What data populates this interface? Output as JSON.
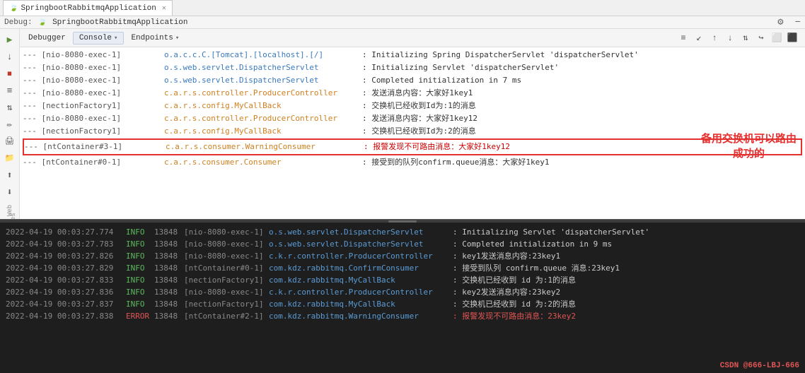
{
  "tabs": [
    {
      "label": "SpringbootRabbitmqApplication",
      "icon": "spring-icon"
    }
  ],
  "debugHeader": {
    "debug_label": "Debug:",
    "title": "SpringbootRabbitmqApplication"
  },
  "consoleTabs": [
    {
      "label": "Debugger",
      "active": false
    },
    {
      "label": "Console",
      "active": true,
      "arrow": "▾"
    },
    {
      "label": "Endpoints",
      "active": false,
      "arrow": "▾"
    }
  ],
  "subToolbarButtons": [
    "≡",
    "↙",
    "↑",
    "↓",
    "⇅",
    "↪",
    "⬜",
    "⬛"
  ],
  "leftToolbar": [
    "▶",
    "⏸",
    "⏹",
    "≡",
    "⇅",
    "✏",
    "🖨",
    "📁",
    "⬆",
    "⬇",
    "*"
  ],
  "logLines": [
    {
      "prefix": "--- [nio-8080-exec-1]",
      "class": "o.a.c.c.C.[Tomcat].[localhost].[/]",
      "msg": ": Initializing Spring DispatcherServlet 'dispatcherServlet'",
      "highlighted": false
    },
    {
      "prefix": "--- [nio-8080-exec-1]",
      "class": "o.s.web.servlet.DispatcherServlet",
      "msg": ": Initializing Servlet 'dispatcherServlet'",
      "highlighted": false
    },
    {
      "prefix": "--- [nio-8080-exec-1]",
      "class": "o.s.web.servlet.DispatcherServlet",
      "msg": ": Completed initialization in 7 ms",
      "highlighted": false
    },
    {
      "prefix": "--- [nio-8080-exec-1]",
      "class": "c.a.r.s.controller.ProducerController",
      "msg": ": 发送消息内容：大家好1key1",
      "highlighted": false,
      "classColor": "orange"
    },
    {
      "prefix": "--- [nectionFactory1]",
      "class": "c.a.r.s.config.MyCallBack",
      "msg": ": 交换机已经收到Id为:1的消息",
      "highlighted": false,
      "classColor": "orange"
    },
    {
      "prefix": "--- [nio-8080-exec-1]",
      "class": "c.a.r.s.controller.ProducerController",
      "msg": ": 发送消息内容：大家好1key12",
      "highlighted": false,
      "classColor": "orange"
    },
    {
      "prefix": "--- [nectionFactory1]",
      "class": "c.a.r.s.config.MyCallBack",
      "msg": ": 交换机已经收到Id为:2的消息",
      "highlighted": false,
      "classColor": "orange"
    },
    {
      "prefix": "--- [ntContainer#3-1]",
      "class": "c.a.r.s.consumer.WarningConsumer",
      "msg": ": 报警发现不可路由消息：大家好1key12",
      "highlighted": true,
      "classColor": "orange",
      "msgColor": "red"
    },
    {
      "prefix": "--- [ntContainer#0-1]",
      "class": "c.a.r.s.consumer.Consumer",
      "msg": ": 接受到的队列confirm.queue消息：大家好1key1",
      "highlighted": false,
      "classColor": "orange"
    }
  ],
  "annotation": {
    "line1": "备用交换机可以路由",
    "line2": "成功的"
  },
  "bottomLogs": [
    {
      "time": "2022-04-19 00:03:27.774",
      "level": "INFO",
      "pid": "13848",
      "thread": "[nio-8080-exec-1]",
      "class": "o.s.web.servlet.DispatcherServlet",
      "msg": ": Initializing Servlet 'dispatcherServlet'"
    },
    {
      "time": "2022-04-19 00:03:27.783",
      "level": "INFO",
      "pid": "13848",
      "thread": "[nio-8080-exec-1]",
      "class": "o.s.web.servlet.DispatcherServlet",
      "msg": ": Completed initialization in 9 ms"
    },
    {
      "time": "2022-04-19 00:03:27.826",
      "level": "INFO",
      "pid": "13848",
      "thread": "[nio-8080-exec-1]",
      "class": "c.k.r.controller.ProducerController",
      "msg": ": key1发送消息内容:23key1"
    },
    {
      "time": "2022-04-19 00:03:27.829",
      "level": "INFO",
      "pid": "13848",
      "thread": "[ntContainer#0-1]",
      "class": "com.kdz.rabbitmq.ConfirmConsumer",
      "msg": ": 接受到队列 confirm.queue 消息:23key1"
    },
    {
      "time": "2022-04-19 00:03:27.833",
      "level": "INFO",
      "pid": "13848",
      "thread": "[nectionFactory1]",
      "class": "com.kdz.rabbitmq.MyCallBack",
      "msg": ": 交换机已经收到 id 为:1的消息"
    },
    {
      "time": "2022-04-19 00:03:27.836",
      "level": "INFO",
      "pid": "13848",
      "thread": "[nio-8080-exec-1]",
      "class": "c.k.r.controller.ProducerController",
      "msg": ": key2发送消息内容:23key2"
    },
    {
      "time": "2022-04-19 00:03:27.837",
      "level": "INFO",
      "pid": "13848",
      "thread": "[nectionFactory1]",
      "class": "com.kdz.rabbitmq.MyCallBack",
      "msg": ": 交换机已经收到 id 为:2的消息"
    },
    {
      "time": "2022-04-19 00:03:27.838",
      "level": "ERROR",
      "pid": "13848",
      "thread": "[ntContainer#2-1]",
      "class": "com.kdz.rabbitmq.WarningConsumer",
      "msg": ": 报警发现不可路由消息：23key2"
    }
  ],
  "csdnBadge": "CSDN @666-LBJ-666"
}
